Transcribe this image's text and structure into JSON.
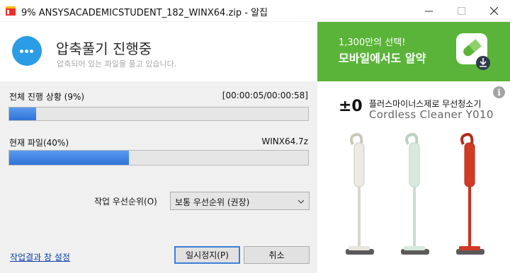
{
  "window": {
    "title": "9% ANSYSACADEMICSTUDENT_182_WINX64.zip - 알집",
    "controls": {
      "minimize": "—",
      "maximize": "☐",
      "close": "✕"
    }
  },
  "header": {
    "title": "압축풀기 진행중",
    "subtitle": "압축되어 있는 파일을 풀고 있습니다.",
    "status_icon": "ellipsis-circle-icon"
  },
  "overall": {
    "label": "전체 진행 상황 (9%)",
    "time": "[00:00:05/00:00:58]",
    "progress_percent": 9
  },
  "current": {
    "label": "현재 파일(40%)",
    "file": "WINX64.7z",
    "progress_percent": 40
  },
  "priority": {
    "label": "작업 우선순위(O)",
    "selected": "보통 우선순위 (권장)"
  },
  "footer": {
    "settings_link": "작업결과 창 설정",
    "pause_button": "일시정지(P)",
    "cancel_button": "취소"
  },
  "ad": {
    "banner_line1": "1,300만의 선택!",
    "banner_line2": "모바일에서도 알약",
    "info": "i",
    "brand": "±0",
    "headline": "플러스마이너스제로 무선청소기",
    "model": "Cordless Cleaner Y010"
  },
  "colors": {
    "accent": "#2a9de4",
    "progress": "#2f73d8",
    "ad_green": "#5ab439",
    "vacuum_white": "#e9e7e0",
    "vacuum_mint": "#d4e8dc",
    "vacuum_red": "#d23a24"
  }
}
